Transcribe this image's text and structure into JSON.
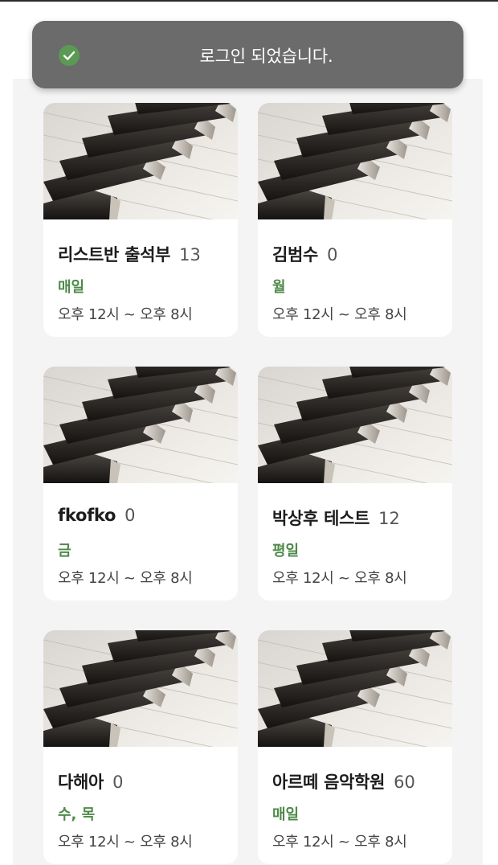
{
  "toast": {
    "message": "로그인 되었습니다.",
    "icon": "check-circle-icon",
    "icon_color": "#5a9a55"
  },
  "classes": [
    {
      "title": "리스트반 출석부",
      "count": "13",
      "days": "매일",
      "time": "오후 12시 ~ 오후 8시",
      "image": "piano-keys-image"
    },
    {
      "title": "김범수",
      "count": "0",
      "days": "월",
      "time": "오후 12시 ~ 오후 8시",
      "image": "piano-keys-image"
    },
    {
      "title": "fkofko",
      "count": "0",
      "days": "금",
      "time": "오후 12시 ~ 오후 8시",
      "image": "piano-keys-image"
    },
    {
      "title": "박상후 테스트",
      "count": "12",
      "days": "평일",
      "time": "오후 12시 ~ 오후 8시",
      "image": "piano-keys-image"
    },
    {
      "title": "다해아",
      "count": "0",
      "days": "수, 목",
      "time": "오후 12시 ~ 오후 8시",
      "image": "piano-keys-image"
    },
    {
      "title": "아르떼 음악학원",
      "count": "60",
      "days": "매일",
      "time": "오후 12시 ~ 오후 8시",
      "image": "piano-keys-image"
    }
  ],
  "colors": {
    "accent_days": "#4f8a4a",
    "toast_bg": "#6b6b6b",
    "content_bg": "#f4f4f4"
  }
}
